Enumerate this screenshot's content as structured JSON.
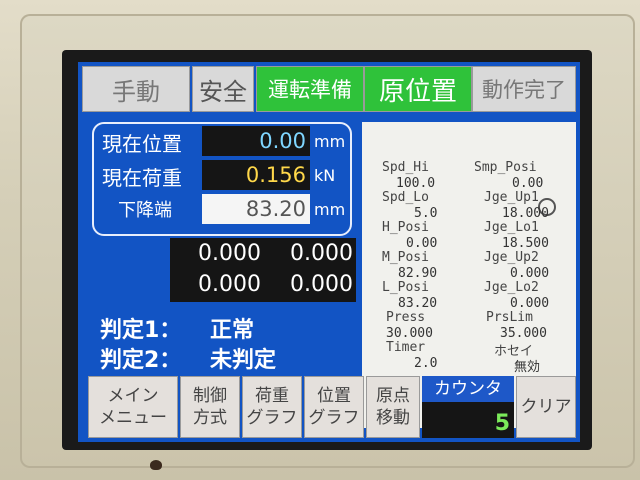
{
  "top_buttons": {
    "manual": "手動",
    "safety": "安全",
    "ready": "運転準備",
    "origin": "原位置",
    "complete": "動作完了"
  },
  "readouts": {
    "position_label": "現在位置",
    "position_value": "0.00",
    "position_unit": "mm",
    "load_label": "現在荷重",
    "load_value": "0.156",
    "load_unit": "kN",
    "bottom_label": "下降端",
    "bottom_value": "83.20",
    "bottom_unit": "mm"
  },
  "grid_values": [
    "0.000",
    "0.000",
    "0.000",
    "0.000"
  ],
  "judgement": {
    "j1_label": "判定1：",
    "j1_value": "正常",
    "j2_label": "判定2：",
    "j2_value": "未判定"
  },
  "params_left": [
    {
      "label": "Spd_Hi",
      "value": "100.0"
    },
    {
      "label": "Spd_Lo",
      "value": "5.0"
    },
    {
      "label": "H_Posi",
      "value": "0.00"
    },
    {
      "label": "M_Posi",
      "value": "82.90"
    },
    {
      "label": "L_Posi",
      "value": "83.20"
    },
    {
      "label": "Press",
      "value": "30.000"
    },
    {
      "label": "Timer",
      "value": "2.0"
    }
  ],
  "params_right": [
    {
      "label": "Smp_Posi",
      "value": "0.00"
    },
    {
      "label": "Jge_Up1",
      "value": "18.000"
    },
    {
      "label": "Jge_Lo1",
      "value": "18.500"
    },
    {
      "label": "Jge_Up2",
      "value": "0.000"
    },
    {
      "label": "Jge_Lo2",
      "value": "0.000"
    },
    {
      "label": "PrsLim",
      "value": "35.000"
    },
    {
      "label": "ホセイ",
      "value": "無効"
    }
  ],
  "bottom_buttons": {
    "main_1": "メイン",
    "main_2": "メニュー",
    "control_1": "制御",
    "control_2": "方式",
    "load_graph_1": "荷重",
    "load_graph_2": "グラフ",
    "pos_graph_1": "位置",
    "pos_graph_2": "グラフ",
    "origin_move_1": "原点",
    "origin_move_2": "移動",
    "counter_label": "カウンタ",
    "counter_value": "5",
    "clear": "クリア"
  },
  "colors": {
    "screen_blue": "#1254c4",
    "green_active": "#2fc23a",
    "value_yellow": "#ffd84a",
    "counter_green": "#7bea5a"
  },
  "icons": {
    "status": "circle-indicator-icon"
  }
}
